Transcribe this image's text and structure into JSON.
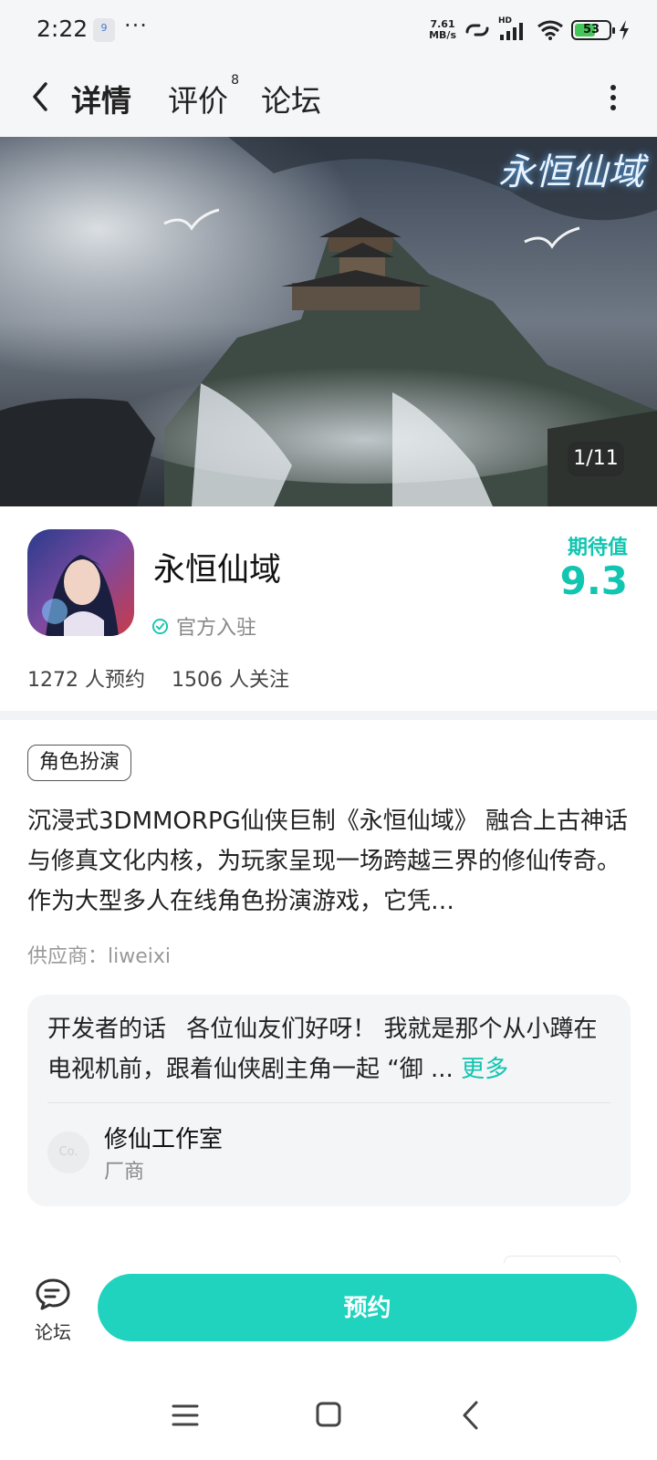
{
  "status_bar": {
    "time": "2:22",
    "app_badge": "9",
    "overflow": "···",
    "net_speed_value": "7.61",
    "net_speed_unit": "MB/s",
    "signal_label": "HD",
    "battery_level": "53"
  },
  "header": {
    "tabs": [
      {
        "label": "详情",
        "active": true
      },
      {
        "label": "评价",
        "badge": "8"
      },
      {
        "label": "论坛"
      }
    ]
  },
  "banner": {
    "logo_text": "永恒仙域",
    "page_indicator": "1/11"
  },
  "game": {
    "name": "永恒仙域",
    "official_label": "官方入驻",
    "expect_label": "期待值",
    "expect_value": "9.3",
    "reservations": "1272 人预约",
    "followers": "1506 人关注",
    "tag": "角色扮演",
    "description": "沉浸式3DMMORPG仙侠巨制《永恒仙域》 融合上古神话与修真文化内核，为玩家呈现一场跨越三界的修仙传奇。作为大型多人在线角色扮演游戏，它凭…",
    "supplier": "供应商：liweixi"
  },
  "developer": {
    "label": "开发者的话",
    "text": "各位仙友们好呀！ 我就是那个从小蹲在电视机前，跟着仙侠剧主角一起 “御 ...",
    "more": "更多",
    "avatar_text": "Co.",
    "studio_name": "修仙工作室",
    "studio_role": "厂商"
  },
  "bottom": {
    "forum_label": "论坛",
    "reserve_label": "预约"
  },
  "colors": {
    "accent": "#1fd3bf",
    "accent_text": "#12c5b0"
  }
}
